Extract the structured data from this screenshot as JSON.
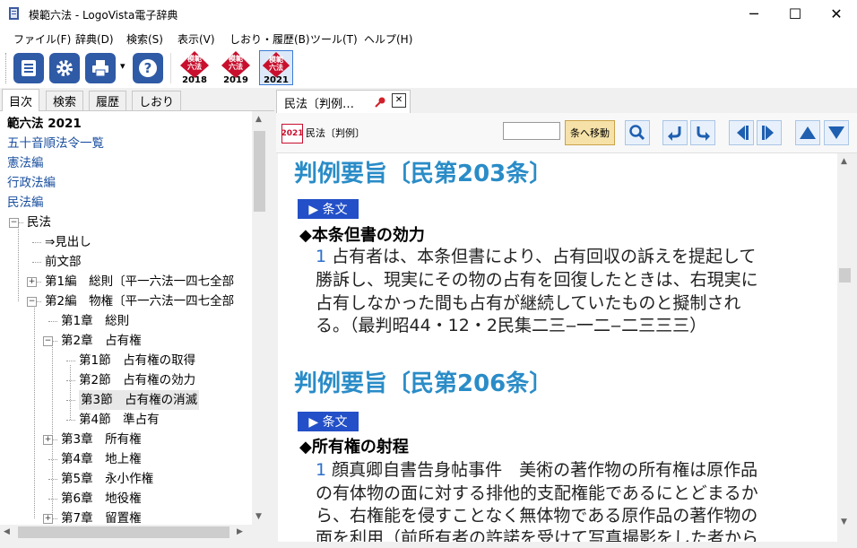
{
  "window": {
    "title": "模範六法 - LogoVista電子辞典",
    "minimize": "─",
    "maximize": "☐",
    "close": "✕"
  },
  "menu": [
    "ファイル(F)",
    "辞典(D)",
    "検索(S)",
    "表示(V)",
    "しおり・履歴(B)",
    "ツール(T)",
    "ヘルプ(H)"
  ],
  "toolbar": {
    "dropdown": "▾",
    "editions": [
      {
        "top": "模範",
        "mid": "六法",
        "year": "2018"
      },
      {
        "top": "模範",
        "mid": "六法",
        "year": "2019"
      },
      {
        "top": "模範",
        "mid": "六法",
        "year": "2021"
      }
    ]
  },
  "left_tabs": [
    "目次",
    "検索",
    "履歴",
    "しおり"
  ],
  "tree": [
    {
      "label": "範六法 2021",
      "level": 0,
      "bold": true,
      "exp": ""
    },
    {
      "label": "五十音順法令一覧",
      "level": 0,
      "link": true,
      "exp": ""
    },
    {
      "label": "憲法編",
      "level": 0,
      "link": true,
      "exp": ""
    },
    {
      "label": "行政法編",
      "level": 0,
      "link": true,
      "exp": ""
    },
    {
      "label": "民法編",
      "level": 0,
      "link": true,
      "exp": ""
    },
    {
      "label": "民法",
      "level": 1,
      "exp": "−"
    },
    {
      "label": "⇒見出し",
      "level": 2,
      "exp": ""
    },
    {
      "label": "前文部",
      "level": 2,
      "exp": ""
    },
    {
      "label": "第1編　総則〔平一六法一四七全部",
      "level": 2,
      "exp": "+"
    },
    {
      "label": "第2編　物権〔平一六法一四七全部",
      "level": 2,
      "exp": "−"
    },
    {
      "label": "第1章　総則",
      "level": 3,
      "exp": ""
    },
    {
      "label": "第2章　占有権",
      "level": 3,
      "exp": "−"
    },
    {
      "label": "第1節　占有権の取得",
      "level": 4,
      "exp": ""
    },
    {
      "label": "第2節　占有権の効力",
      "level": 4,
      "exp": ""
    },
    {
      "label": "第3節　占有権の消滅",
      "level": 4,
      "exp": "",
      "selected": true
    },
    {
      "label": "第4節　準占有",
      "level": 4,
      "exp": ""
    },
    {
      "label": "第3章　所有権",
      "level": 3,
      "exp": "+"
    },
    {
      "label": "第4章　地上権",
      "level": 3,
      "exp": ""
    },
    {
      "label": "第5章　永小作権",
      "level": 3,
      "exp": ""
    },
    {
      "label": "第6章　地役権",
      "level": 3,
      "exp": ""
    },
    {
      "label": "第7章　留置権",
      "level": 3,
      "exp": "+"
    }
  ],
  "doc_tab": {
    "label": "民法〔判例…",
    "close": "✕"
  },
  "nav": {
    "badge": "2021",
    "title": "民法〔判例〕",
    "goto_button": "条へ移動",
    "search_value": ""
  },
  "content": {
    "sections": [
      {
        "heading": "判例要旨〔民第203条〕",
        "jobun": "▶ 条文",
        "subhead": "◆本条但書の効力",
        "lines": [
          {
            "num": "1",
            "text": " 占有者は、本条但書により、占有回収の訴えを提起して"
          },
          {
            "num": "",
            "text": "勝訴し、現実にその物の占有を回復したときは、右現実に"
          },
          {
            "num": "",
            "text": "占有しなかった間も占有が継続していたものと擬制され"
          },
          {
            "num": "",
            "text": "る。（最判昭44・12・2民集二三‒一二‒二三三三）"
          }
        ]
      },
      {
        "heading": "判例要旨〔民第206条〕",
        "jobun": "▶ 条文",
        "subhead": "◆所有権の射程",
        "lines": [
          {
            "num": "1",
            "text": " 顔真卿自書告身帖事件　美術の著作物の所有権は原作品"
          },
          {
            "num": "",
            "text": "の有体物の面に対する排他的支配権能であるにとどまるか"
          },
          {
            "num": "",
            "text": "ら、右権能を侵すことなく無体物である原作品の著作物の"
          },
          {
            "num": "",
            "text": "面を利用（前所有者の許諾を受けて写真撮影をした者から"
          }
        ]
      }
    ]
  }
}
